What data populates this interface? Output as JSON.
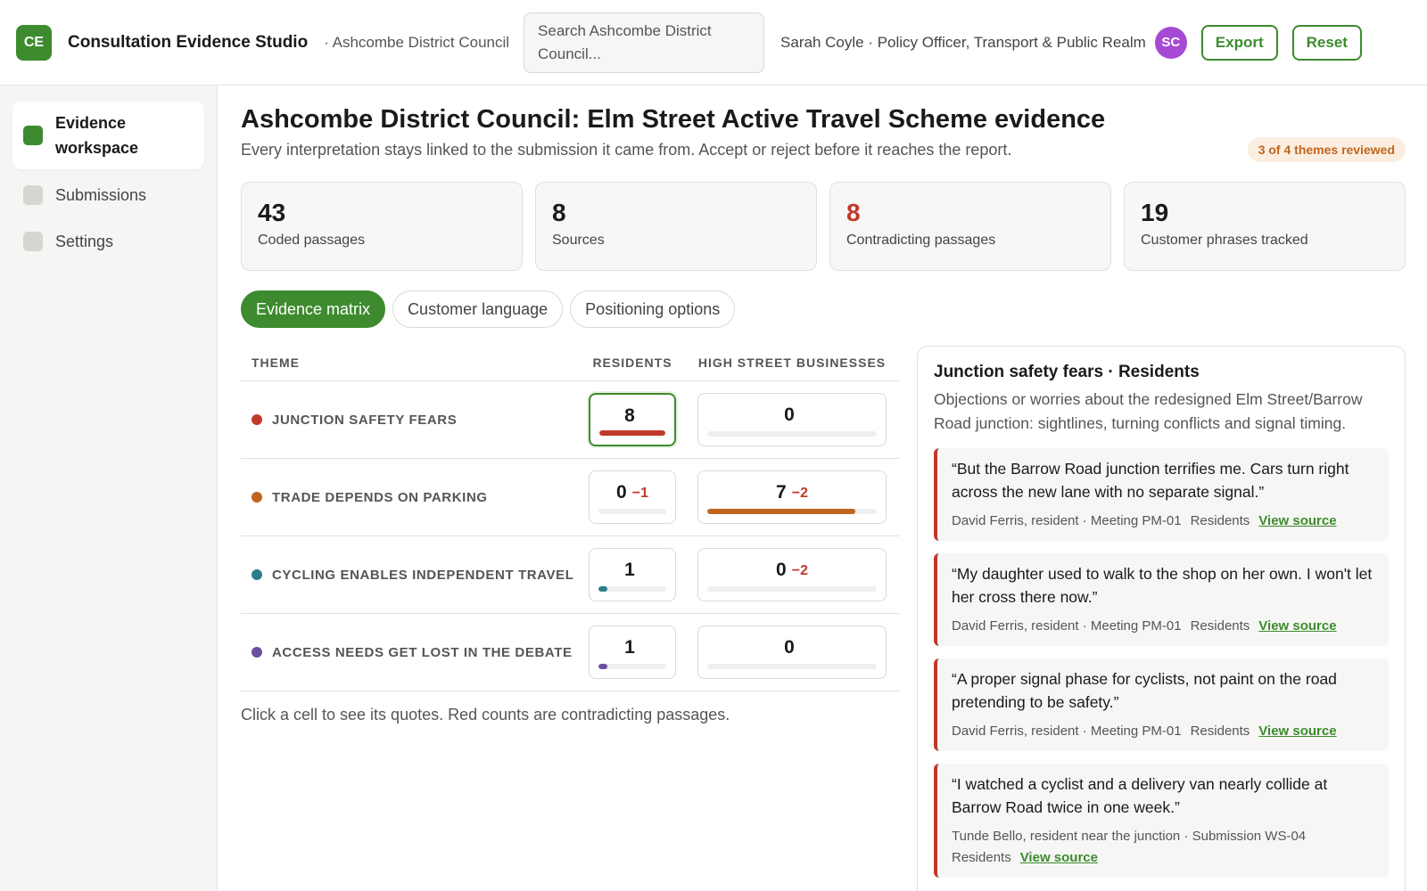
{
  "header": {
    "logo": "CE",
    "app_title": "Consultation Evidence Studio",
    "org": "· Ashcombe District Council",
    "search_placeholder_line1": "Search Ashcombe District",
    "search_placeholder_line2": "Council...",
    "user": "Sarah Coyle · Policy Officer, Transport & Public Realm",
    "avatar": "SC",
    "export_label": "Export",
    "reset_label": "Reset"
  },
  "sidebar": {
    "items": [
      {
        "label_line1": "Evidence",
        "label_line2": "workspace",
        "active": true
      },
      {
        "label": "Submissions",
        "active": false
      },
      {
        "label": "Settings",
        "active": false
      }
    ]
  },
  "page": {
    "title": "Ashcombe District Council: Elm Street Active Travel Scheme evidence",
    "subtitle": "Every interpretation stays linked to the submission it came from. Accept or reject before it reaches the report.",
    "badge": "3 of 4 themes reviewed"
  },
  "stats": [
    {
      "value": "43",
      "label": "Coded passages"
    },
    {
      "value": "8",
      "label": "Sources"
    },
    {
      "value": "8",
      "label": "Contradicting passages"
    },
    {
      "value": "19",
      "label": "Customer phrases tracked"
    }
  ],
  "tabs": [
    "Evidence matrix",
    "Customer language",
    "Positioning options"
  ],
  "matrix": {
    "headers": {
      "theme": "THEME",
      "residents": "RESIDENTS",
      "businesses": "HIGH STREET BUSINESSES"
    },
    "rows": [
      {
        "theme": "JUNCTION SAFETY FEARS",
        "color": "#c0392b",
        "res": {
          "count": "8",
          "contra": "",
          "fill": 1.0
        },
        "biz": {
          "count": "0",
          "contra": "",
          "fill": 0
        }
      },
      {
        "theme": "TRADE DEPENDS ON PARKING",
        "color": "#c0651e",
        "res": {
          "count": "0",
          "contra": "−1",
          "fill": 0
        },
        "biz": {
          "count": "7",
          "contra": "−2",
          "fill": 0.875
        }
      },
      {
        "theme": "CYCLING ENABLES INDEPENDENT TRAVEL",
        "color": "#2e7d8a",
        "res": {
          "count": "1",
          "contra": "",
          "fill": 0.125
        },
        "biz": {
          "count": "0",
          "contra": "−2",
          "fill": 0
        }
      },
      {
        "theme": "ACCESS NEEDS GET LOST IN THE DEBATE",
        "color": "#6b4fa0",
        "res": {
          "count": "1",
          "contra": "",
          "fill": 0.125
        },
        "biz": {
          "count": "0",
          "contra": "",
          "fill": 0
        }
      }
    ],
    "hint": "Click a cell to see its quotes. Red counts are contradicting passages."
  },
  "panel": {
    "title": "Junction safety fears · Residents",
    "description": "Objections or worries about the redesigned Elm Street/Barrow Road junction: sightlines, turning conflicts and signal timing.",
    "quotes": [
      {
        "text": "“But the Barrow Road junction terrifies me. Cars turn right across the new lane with no separate signal.”",
        "source": "David Ferris, resident · Meeting PM-01",
        "group": "Residents",
        "link": "View source"
      },
      {
        "text": "“My daughter used to walk to the shop on her own. I won't let her cross there now.”",
        "source": "David Ferris, resident · Meeting PM-01",
        "group": "Residents",
        "link": "View source"
      },
      {
        "text": "“A proper signal phase for cyclists, not paint on the road pretending to be safety.”",
        "source": "David Ferris, resident · Meeting PM-01",
        "group": "Residents",
        "link": "View source"
      },
      {
        "text": "“I watched a cyclist and a delivery van nearly collide at Barrow Road twice in one week.”",
        "source": "Tunde Bello, resident near the junction · Submission WS-04",
        "group": "Residents",
        "link": "View source"
      }
    ]
  }
}
